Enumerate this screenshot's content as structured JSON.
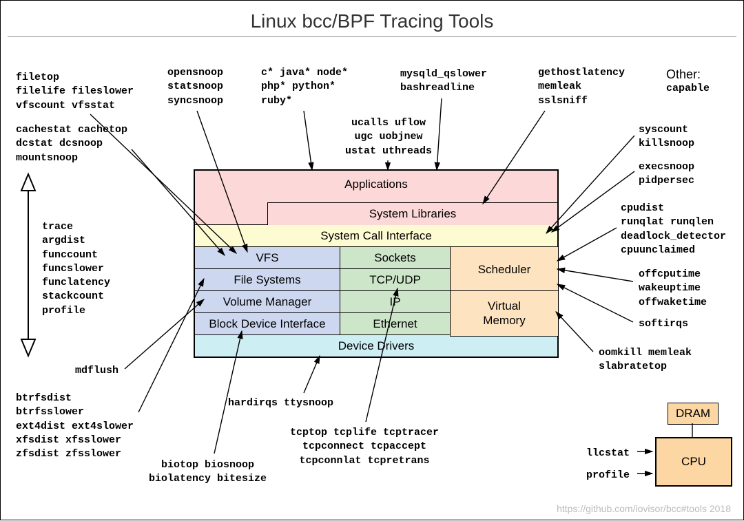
{
  "title": "Linux bcc/BPF Tracing Tools",
  "footer": "https://github.com/iovisor/bcc#tools 2018",
  "stack": {
    "applications": "Applications",
    "syslib": "System Libraries",
    "syscall": "System Call Interface",
    "vfs": "VFS",
    "sockets": "Sockets",
    "scheduler": "Scheduler",
    "fs": "File Systems",
    "tcpudp": "TCP/UDP",
    "volmgr": "Volume Manager",
    "ip": "IP",
    "vmem": "Virtual\nMemory",
    "bdi": "Block Device Interface",
    "eth": "Ethernet",
    "devdrv": "Device Drivers"
  },
  "labels": {
    "filetop": "filetop\nfilelife fileslower\nvfscount vfsstat",
    "opensnoop": "opensnoop\nstatsnoop\nsyncsnoop",
    "cjava": "c* java* node*\nphp* python*\nruby*",
    "mysqld": "mysqld_qslower\nbashreadline",
    "gethost": "gethostlatency\nmemleak\nsslsniff",
    "other_hdr": "Other:",
    "capable": "capable",
    "ucalls": "ucalls uflow\nugc uobjnew\nustat uthreads",
    "cachestat": "cachestat cachetop\ndcstat dcsnoop\nmountsnoop",
    "syscount": "syscount\nkillsnoop",
    "execsnoop": "execsnoop\npidpersec",
    "cpudist": "cpudist\nrunqlat runqlen\ndeadlock_detector\ncpuunclaimed",
    "offcpu": "offcputime\nwakeuptime\noffwaketime",
    "softirqs": "softirqs",
    "oomkill": "oomkill memleak\nslabratetop",
    "trace": "trace\nargdist\nfunccount\nfuncslower\nfunclatency\nstackcount\nprofile",
    "mdflush": "mdflush",
    "btrfs": "btrfsdist\nbtrfsslower\next4dist ext4slower\nxfsdist xfsslower\nzfsdist zfsslower",
    "biotop": "biotop biosnoop\nbiolatency bitesize",
    "hardirqs": "hardirqs ttysnoop",
    "tcptop": "tcptop tcplife tcptracer\ntcpconnect tcpaccept\ntcpconnlat tcpretrans",
    "llcstat": "llcstat",
    "profile": "profile"
  },
  "hw": {
    "dram": "DRAM",
    "cpu": "CPU"
  }
}
